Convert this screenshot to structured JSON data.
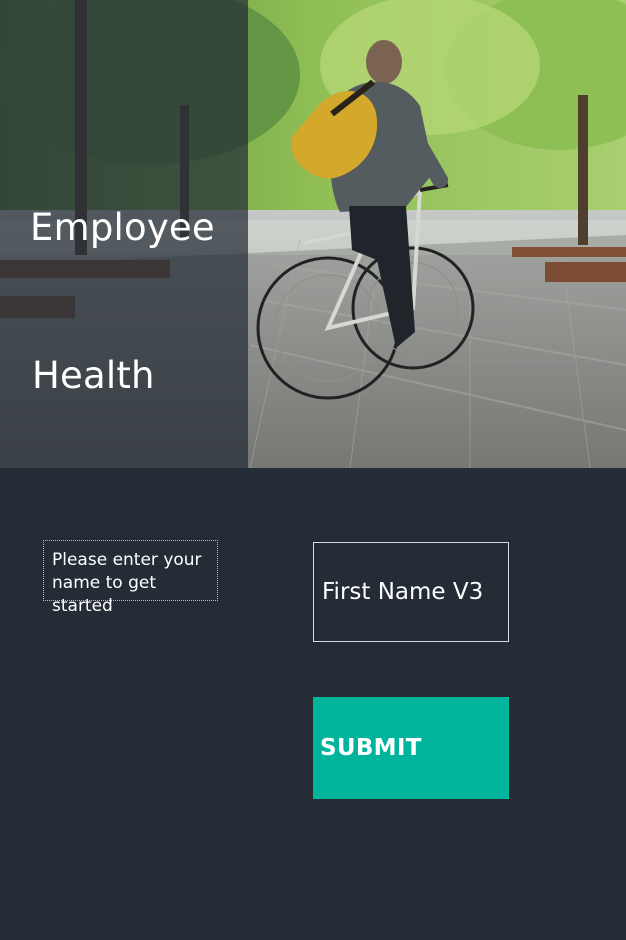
{
  "hero": {
    "title_line1": "Employee",
    "title_line2": "Health",
    "image_subject": "person riding a bicycle in a tree-lined park"
  },
  "instructions": {
    "text": "Please enter your name to get started"
  },
  "form": {
    "first_name_placeholder": "First Name V3",
    "first_name_value": "",
    "submit_label": "SUBMIT"
  },
  "colors": {
    "background": "#242d36",
    "accent": "#00b39b",
    "text": "#ffffff",
    "field_border": "#d8dde2"
  }
}
